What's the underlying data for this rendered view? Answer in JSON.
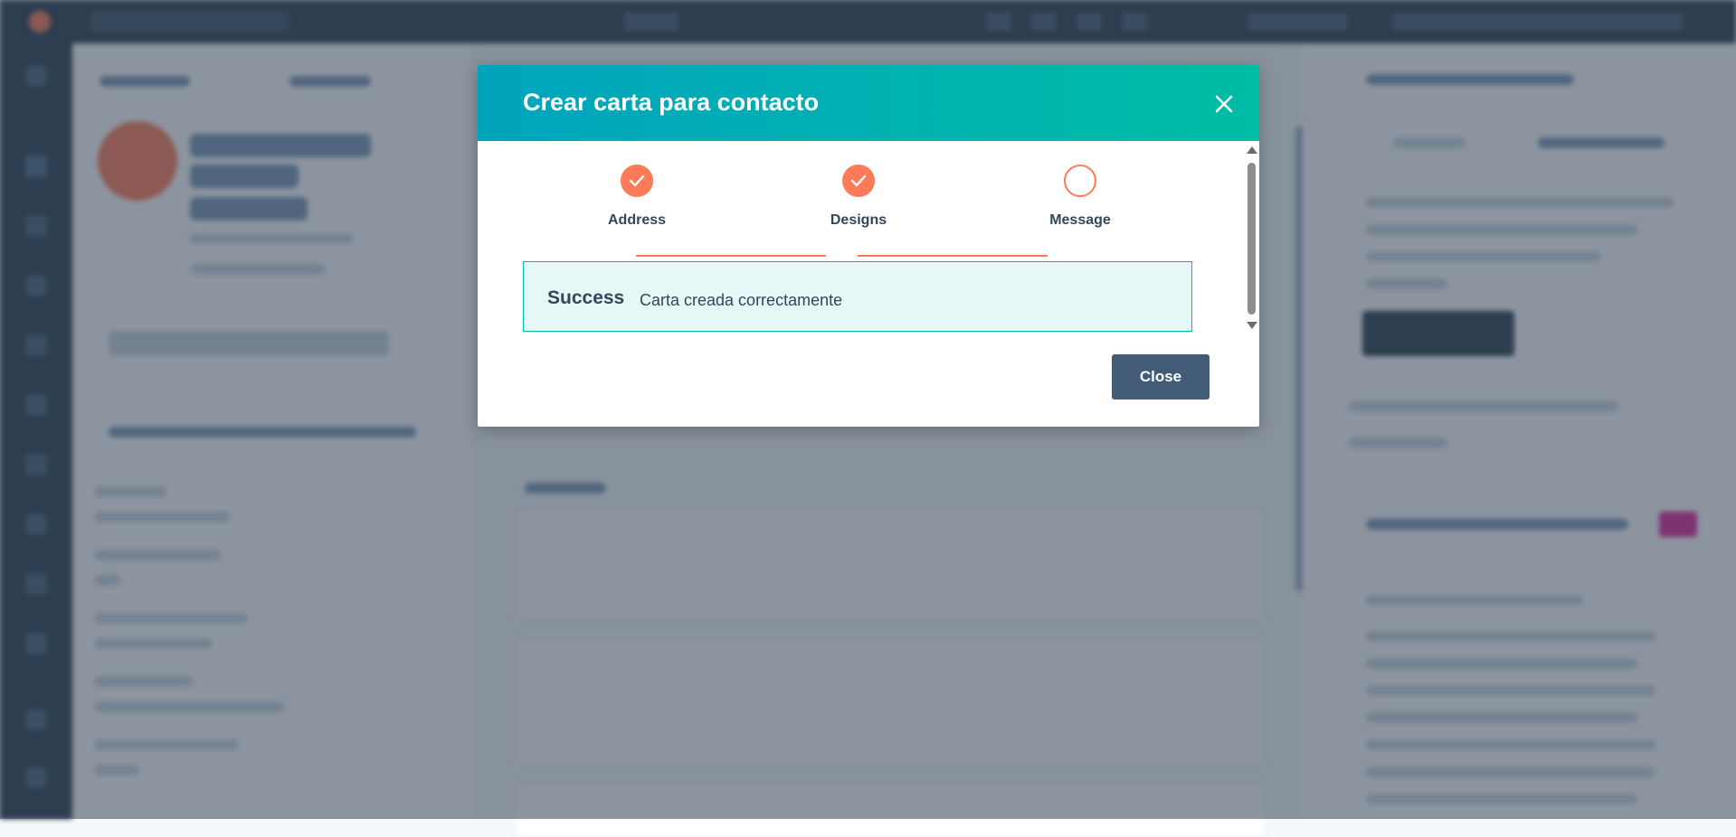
{
  "modal": {
    "title": "Crear carta para contacto",
    "close_icon": "close-icon",
    "steps": [
      {
        "label": "Address",
        "status": "complete"
      },
      {
        "label": "Designs",
        "status": "complete"
      },
      {
        "label": "Message",
        "status": "current"
      }
    ],
    "alert": {
      "title": "Success",
      "message": "Carta creada correctamente"
    },
    "close_button": "Close"
  },
  "colors": {
    "header_gradient_start": "#00a4bd",
    "header_gradient_end": "#00bda5",
    "step_accent": "#ff7a59",
    "success_bg": "#e5f8f6",
    "success_border": "#00bda5",
    "primary_button": "#425b76",
    "overlay": "#2d3e50"
  }
}
